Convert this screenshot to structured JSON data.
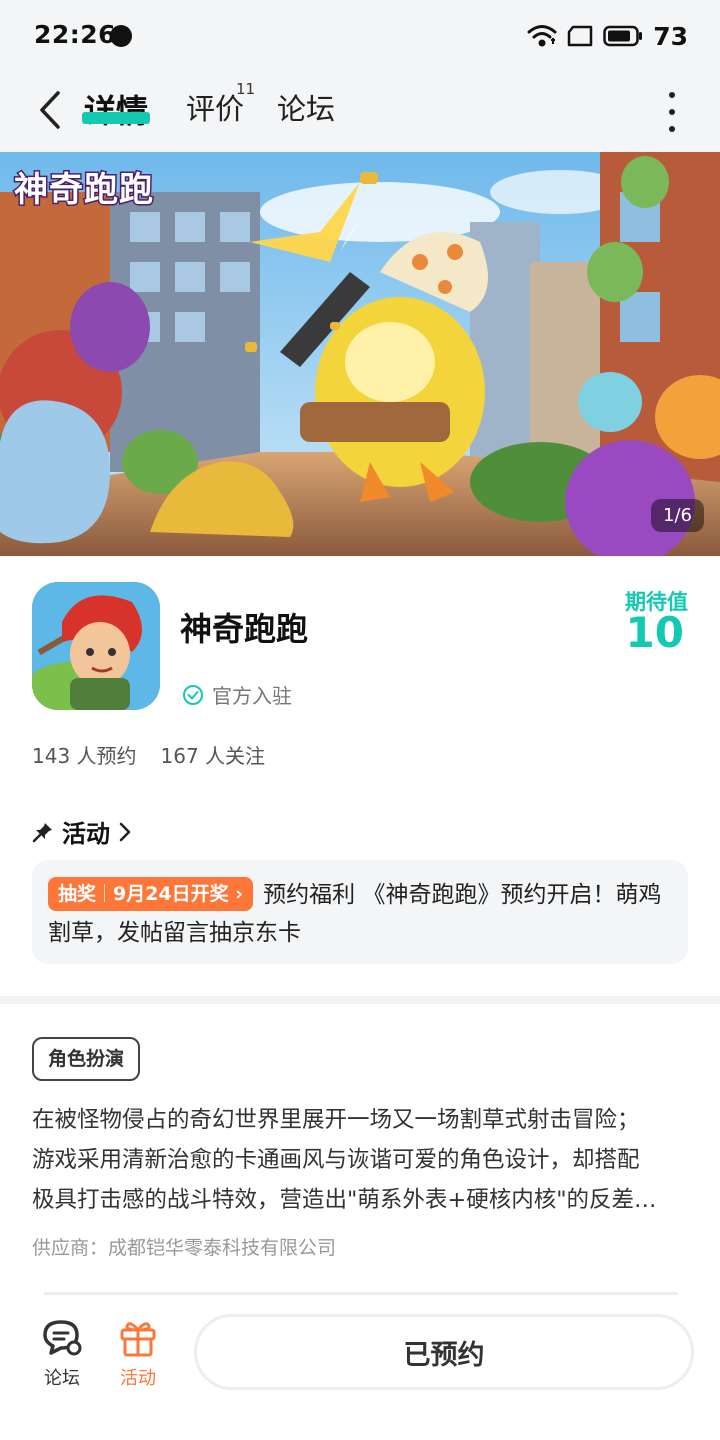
{
  "status_bar": {
    "time": "22:26",
    "battery": "73",
    "icons": [
      "notification-dot-icon",
      "wifi-icon",
      "screen-icon",
      "battery-icon"
    ]
  },
  "nav": {
    "back_icon": "chevron-left-icon",
    "tabs": [
      {
        "label": "详情",
        "active": true
      },
      {
        "label": "评价",
        "count": "11"
      },
      {
        "label": "论坛"
      }
    ],
    "more_icon": "more-vertical-icon",
    "accent_color": "#14c9b2"
  },
  "banner": {
    "logo_text": "神奇跑跑",
    "counter": "1/6"
  },
  "app": {
    "name": "神奇跑跑",
    "official_label": "官方入驻",
    "expect_label": "期待值",
    "expect_value": "10",
    "reservations": "143 人预约",
    "followers": "167 人关注"
  },
  "activity": {
    "title": "活动",
    "badge_left": "抽奖",
    "badge_right": "9月24日开奖",
    "badge_color": "#fe7638",
    "text": "预约福利 《神奇跑跑》预约开启！萌鸡割草，发帖留言抽京东卡"
  },
  "details": {
    "genre": "角色扮演",
    "description_lines": [
      "在被怪物侵占的奇幻世界里展开一场又一场割草式射击冒险；",
      "游戏采用清新治愈的卡通画风与诙谐可爱的角色设计，却搭配",
      "极具打击感的战斗特效，营造出\"萌系外表+硬核内核\"的反差…"
    ],
    "supplier": "供应商：成都铠华零泰科技有限公司"
  },
  "bottom": {
    "forum_label": "论坛",
    "activity_label": "活动",
    "reserve_label": "已预约",
    "activity_color": "#fe7638"
  }
}
